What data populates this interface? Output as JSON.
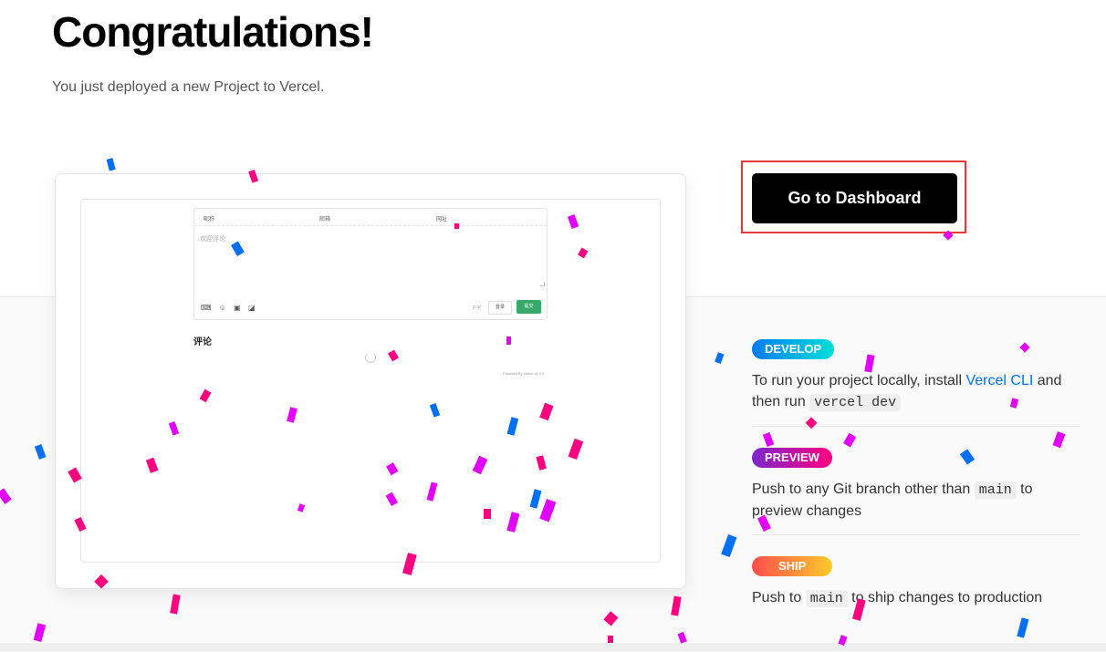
{
  "header": {
    "title": "Congratulations!",
    "subtitle": "You just deployed a new Project to Vercel."
  },
  "preview": {
    "fields": [
      "昵称",
      "邮箱",
      "网址"
    ],
    "placeholder": "欢迎评论",
    "tool_icons": "⌨ ☺ ▣ ◪",
    "char_count": "0 字",
    "login_label": "登录",
    "submit_label": "提交",
    "comments_heading": "评论",
    "powered_by": "Powered By Valine v1.4.0"
  },
  "cta": {
    "dashboard_label": "Go to Dashboard"
  },
  "steps": [
    {
      "badge": "DEVELOP",
      "text_before": "To run your project locally, install ",
      "link": "Vercel CLI",
      "text_mid": " and then run ",
      "code": "vercel dev",
      "text_after": ""
    },
    {
      "badge": "PREVIEW",
      "text_before": "Push to any Git branch other than ",
      "code": "main",
      "text_after": " to preview changes"
    },
    {
      "badge": "SHIP",
      "text_before": "Push to ",
      "code": "main",
      "text_after": " to ship changes to production"
    }
  ],
  "colors": {
    "confetti": [
      "#ff0080",
      "#0070f3",
      "#e100ff"
    ],
    "link": "#0070f3",
    "button_bg": "#000000"
  }
}
